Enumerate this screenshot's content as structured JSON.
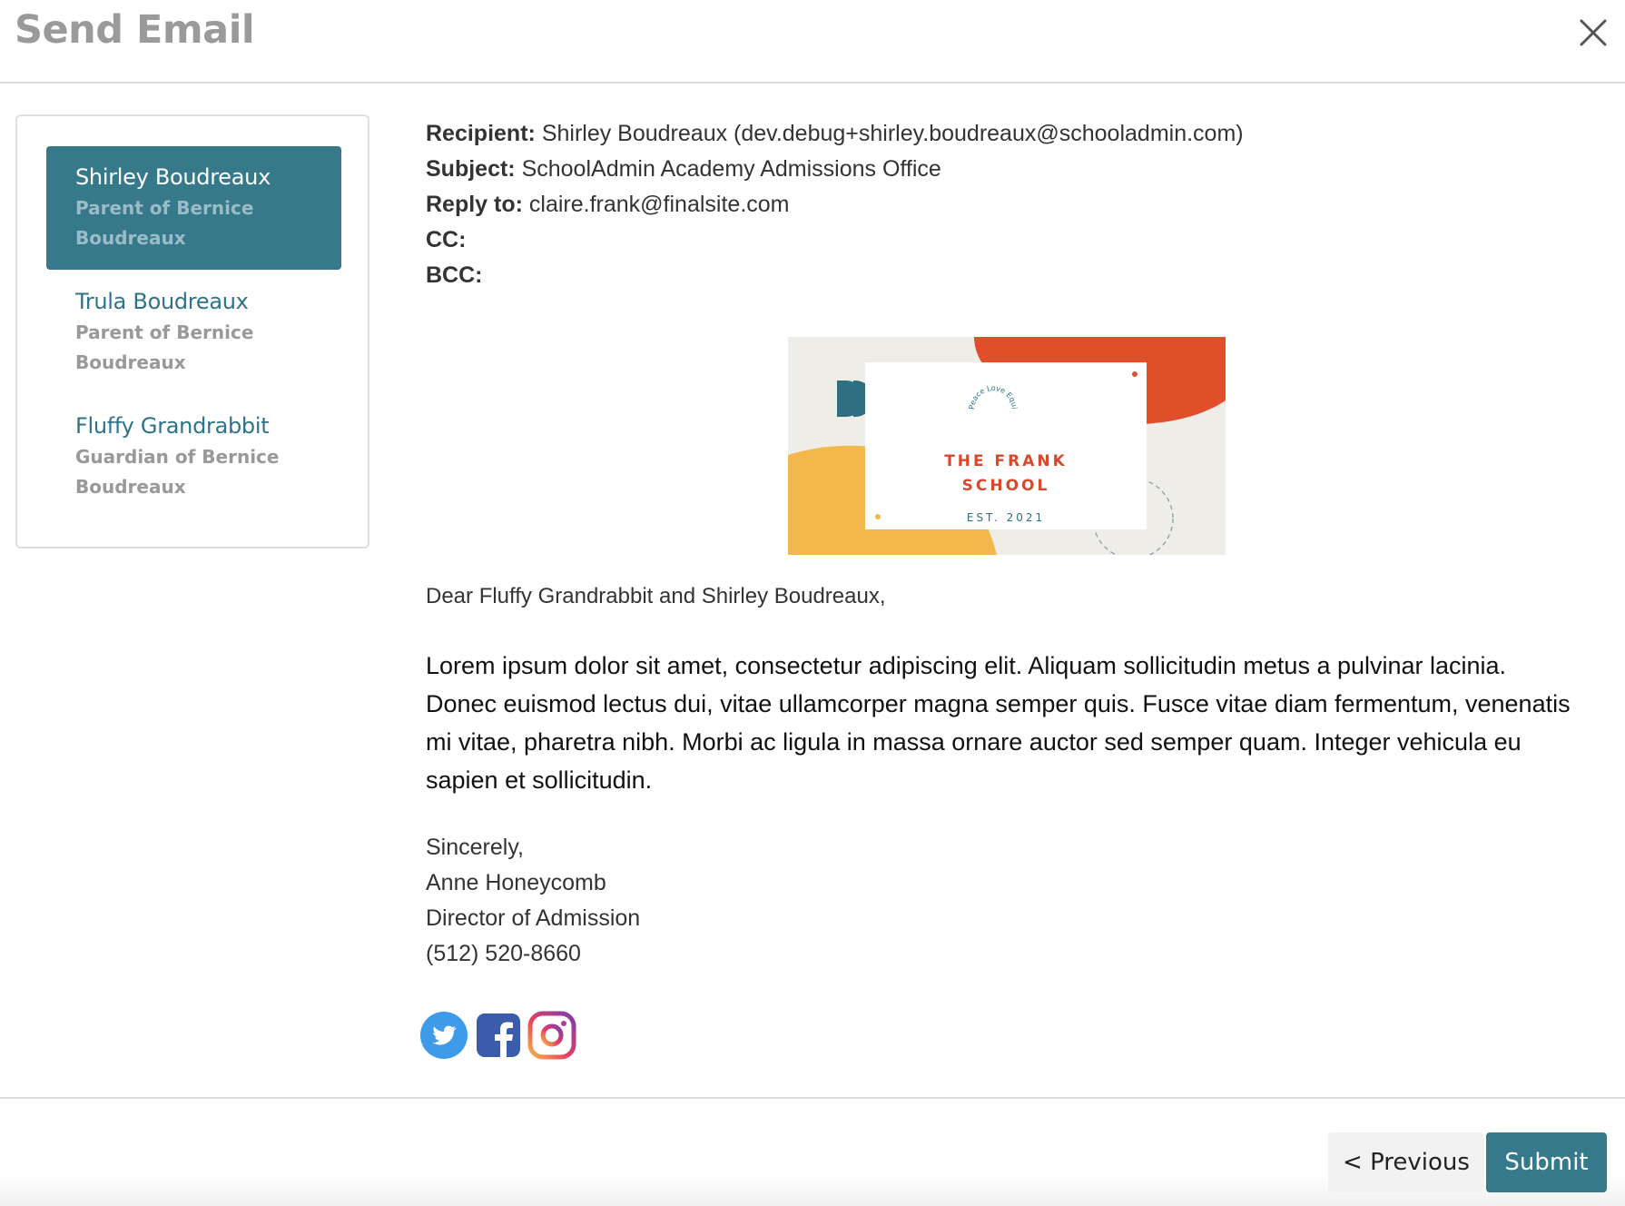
{
  "dialog": {
    "title": "Send Email"
  },
  "recipients": [
    {
      "name": "Shirley Boudreaux",
      "role": "Parent of Bernice Boudreaux",
      "selected": true
    },
    {
      "name": "Trula Boudreaux",
      "role": "Parent of Bernice Boudreaux",
      "selected": false
    },
    {
      "name": "Fluffy Grandrabbit",
      "role": "Guardian of Bernice Boudreaux",
      "selected": false
    }
  ],
  "email": {
    "recipient_label": "Recipient:",
    "recipient_value": "Shirley Boudreaux (dev.debug+shirley.boudreaux@schooladmin.com)",
    "subject_label": "Subject:",
    "subject_value": "SchoolAdmin Academy Admissions Office",
    "reply_to_label": "Reply to:",
    "reply_to_value": "claire.frank@finalsite.com",
    "cc_label": "CC:",
    "bcc_label": "BCC:",
    "banner": {
      "arc_text": "Peace Love Equity",
      "school_line1": "THE FRANK",
      "school_line2": "SCHOOL",
      "established": "EST. 2021"
    },
    "greeting": "Dear Fluffy Grandrabbit and Shirley Boudreaux,",
    "body": "Lorem ipsum dolor sit amet, consectetur adipiscing elit. Aliquam sollicitudin metus a pulvinar lacinia. Donec euismod lectus dui, vitae ullamcorper magna semper quis. Fusce vitae diam fermentum, venenatis mi vitae, pharetra nibh. Morbi ac ligula in massa ornare auctor sed semper quam. Integer vehicula eu sapien et sollicitudin.",
    "signature": {
      "closing": "Sincerely,",
      "name": "Anne Honeycomb",
      "title": "Director of Admission",
      "phone": "(512) 520-8660"
    },
    "socials": [
      "twitter-icon",
      "facebook-icon",
      "instagram-icon"
    ]
  },
  "footer": {
    "previous_label": "< Previous",
    "submit_label": "Submit"
  },
  "colors": {
    "accent": "#36798b",
    "banner_orange": "#e04e2a",
    "banner_yellow": "#f2b84b",
    "banner_bg": "#eeede7"
  }
}
